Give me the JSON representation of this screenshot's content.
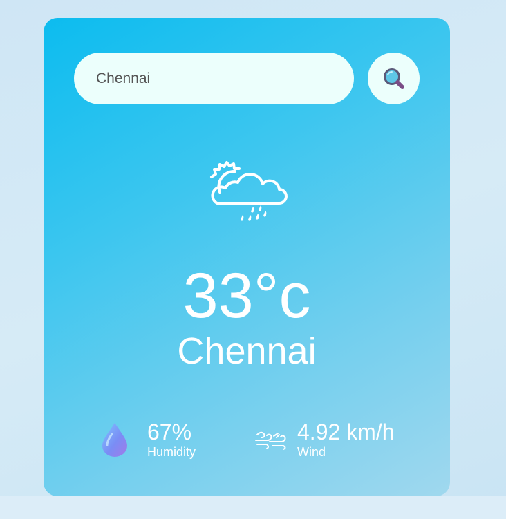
{
  "search": {
    "value": "Chennai",
    "button_icon": "search-icon"
  },
  "weather": {
    "condition_icon": "sun-cloud-rain-icon",
    "temperature": "33°c",
    "city": "Chennai"
  },
  "details": {
    "humidity": {
      "icon": "water-drop-icon",
      "value": "67%",
      "label": "Humidity"
    },
    "wind": {
      "icon": "wind-icon",
      "value": "4.92 km/h",
      "label": "Wind"
    }
  },
  "colors": {
    "card_start": "#0cbcef",
    "card_end": "#a0d8ee",
    "search_bg": "#ecfffc",
    "text": "#ffffff"
  }
}
